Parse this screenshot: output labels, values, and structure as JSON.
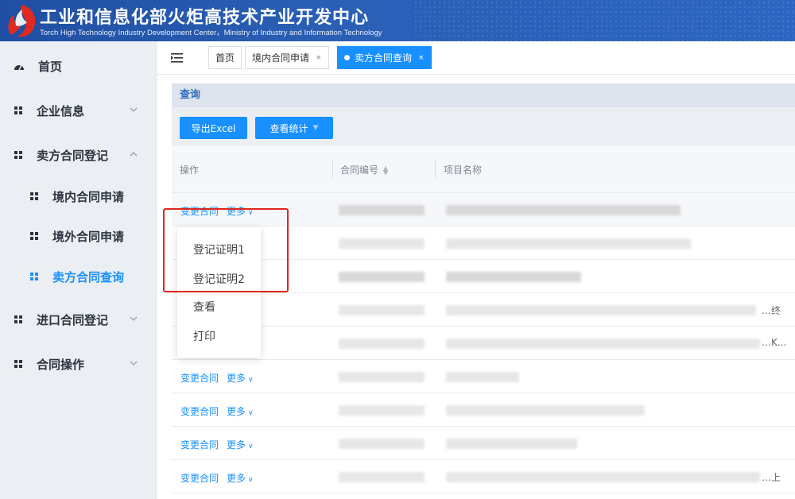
{
  "header": {
    "title_cn": "工业和信息化部火炬高技术产业开发中心",
    "title_en": "Torch High Technology Industry Development Center，Ministry of Industry and Information Technology"
  },
  "sidebar": {
    "items": [
      {
        "label": "首页",
        "icon": "gauge-icon"
      },
      {
        "label": "企业信息",
        "icon": "grid-icon",
        "chevron": "down"
      },
      {
        "label": "卖方合同登记",
        "icon": "grid-icon",
        "chevron": "up"
      },
      {
        "label": "境内合同申请",
        "icon": "grid-icon"
      },
      {
        "label": "境外合同申请",
        "icon": "grid-icon"
      },
      {
        "label": "卖方合同查询",
        "icon": "grid-icon",
        "active": true
      },
      {
        "label": "进口合同登记",
        "icon": "grid-icon",
        "chevron": "down"
      },
      {
        "label": "合同操作",
        "icon": "grid-icon",
        "chevron": "down"
      }
    ]
  },
  "tabs": [
    {
      "label": "首页"
    },
    {
      "label": "境内合同申请",
      "close": "×"
    },
    {
      "label": "卖方合同查询",
      "close": "×",
      "active": true
    }
  ],
  "query": {
    "title": "查询",
    "export_label": "导出Excel",
    "stats_label": "查看统计"
  },
  "table": {
    "headers": [
      "操作",
      "合同编号",
      "项目名称"
    ],
    "op_change": "变更合同",
    "op_more": "更多",
    "row_tails": [
      "",
      "",
      "",
      "…终",
      "…K...",
      "",
      "",
      "",
      "…上"
    ]
  },
  "dropdown": {
    "items": [
      "登记证明1",
      "登记证明2",
      "查看",
      "打印"
    ]
  },
  "colors": {
    "accent": "#1890ff",
    "header_bg": "#1f4fa3",
    "highlight_red": "#e0261f"
  }
}
